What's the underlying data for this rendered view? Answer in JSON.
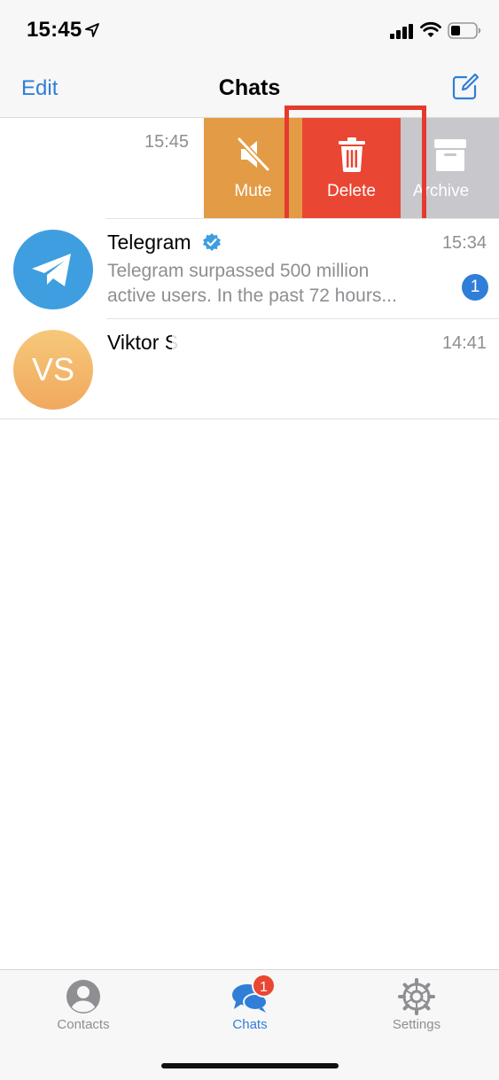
{
  "status_bar": {
    "time": "15:45"
  },
  "nav": {
    "edit_label": "Edit",
    "title": "Chats"
  },
  "swiped_chat": {
    "time": "15:45",
    "actions": {
      "mute": "Mute",
      "delete": "Delete",
      "archive": "Archive"
    }
  },
  "chats": [
    {
      "name": "Telegram",
      "verified": true,
      "time": "15:34",
      "preview_line1": "Telegram surpassed 500 million",
      "preview_line2": "active users.    In the past 72 hours...",
      "unread": "1"
    },
    {
      "name": "Viktor S",
      "avatar_initials": "VS",
      "time": "14:41"
    }
  ],
  "tabs": [
    {
      "label": "Contacts"
    },
    {
      "label": "Chats",
      "badge": "1",
      "active": true
    },
    {
      "label": "Settings"
    }
  ],
  "colors": {
    "accent": "#2f7ed8",
    "mute": "#e39b45",
    "delete": "#e94633",
    "archive": "#c7c7cc",
    "highlight": "#e53a2e"
  }
}
